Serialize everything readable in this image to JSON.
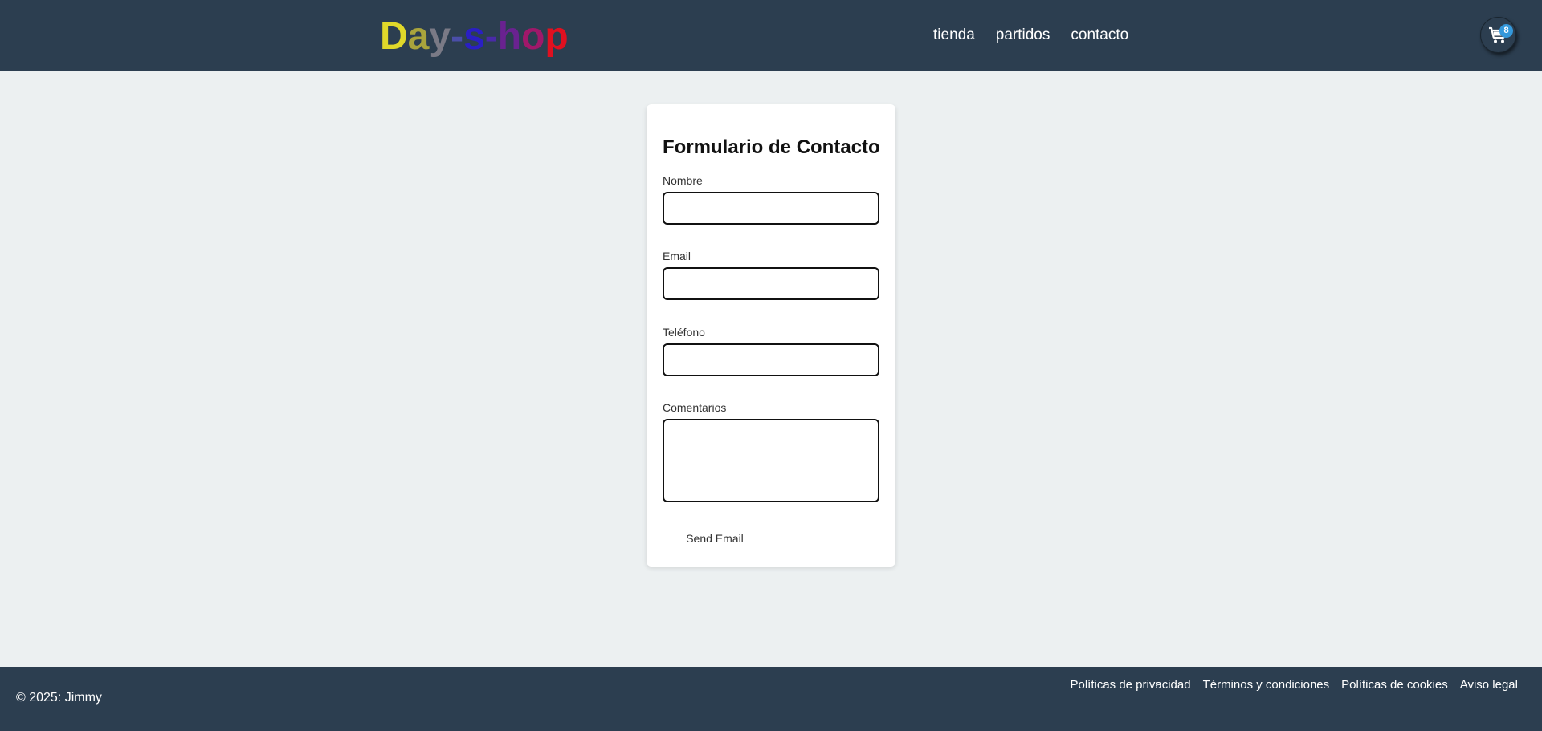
{
  "header": {
    "logo": {
      "parts": [
        {
          "text": "D",
          "color": "#e0d82a"
        },
        {
          "text": "a",
          "color": "#a9a43c"
        },
        {
          "text": "y",
          "color": "#7a7a86"
        },
        {
          "text": "-",
          "color": "#4a4ea8"
        },
        {
          "text": "s",
          "color": "#2a1fc4"
        },
        {
          "text": "-",
          "color": "#4a2aa8"
        },
        {
          "text": "h",
          "color": "#6a2290"
        },
        {
          "text": "o",
          "color": "#a0186a"
        },
        {
          "text": "p",
          "color": "#e01020"
        }
      ]
    },
    "nav": [
      {
        "label": "tienda"
      },
      {
        "label": "partidos"
      },
      {
        "label": "contacto"
      }
    ],
    "cart": {
      "icon": "cart-icon",
      "count": "8",
      "badge_color": "#3498db"
    }
  },
  "form": {
    "title": "Formulario de Contacto",
    "fields": {
      "nombre": {
        "label": "Nombre",
        "value": ""
      },
      "email": {
        "label": "Email",
        "value": ""
      },
      "telefono": {
        "label": "Teléfono",
        "value": ""
      },
      "comentarios": {
        "label": "Comentarios",
        "value": ""
      }
    },
    "submit_label": "Send Email"
  },
  "footer": {
    "copyright": "© 2025: Jimmy",
    "links": [
      {
        "label": "Políticas de privacidad"
      },
      {
        "label": "Términos y condiciones"
      },
      {
        "label": "Políticas de cookies"
      },
      {
        "label": "Aviso legal"
      }
    ]
  },
  "colors": {
    "header_bg": "#2c3e50",
    "page_bg": "#ecf0f1",
    "accent": "#3498db"
  }
}
